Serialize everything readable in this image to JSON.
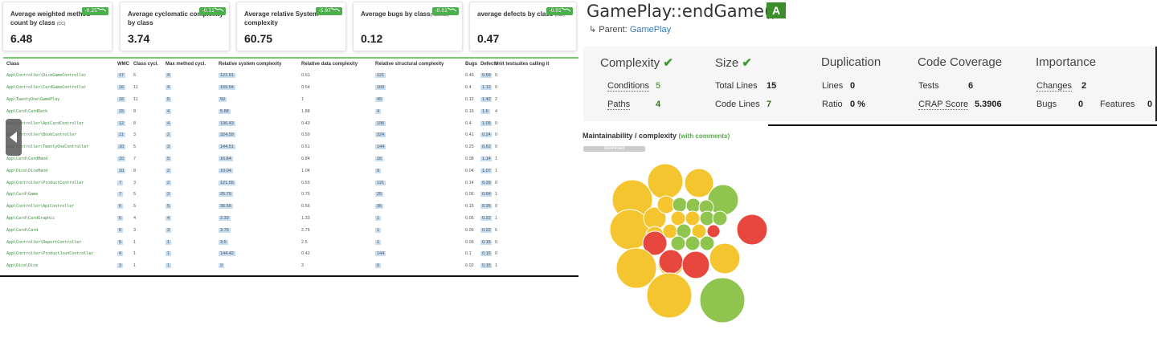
{
  "cards": [
    {
      "title": "Average weighted method count by class",
      "note": "(CC)",
      "value": "6.48",
      "badge": "-0.25"
    },
    {
      "title": "Average cyclomatic complexity by class",
      "note": "",
      "value": "3.74",
      "badge": "-0.11"
    },
    {
      "title": "Average relative System complexity",
      "note": "",
      "value": "60.75",
      "badge": "-5.97"
    },
    {
      "title": "Average bugs by class",
      "note": "(Halstead)",
      "value": "0.12",
      "badge": "-0.01"
    },
    {
      "title": "average defects by class",
      "note": "(Kan)",
      "value": "0.47",
      "badge": "-0.01"
    }
  ],
  "table": {
    "headers": [
      "Class",
      "WMC",
      "Class cycl.",
      "Max method cycl.",
      "Relative system complexity",
      "Relative data complexity",
      "Relative structural complexity",
      "Bugs",
      "Defects",
      "Unit testsuites calling it"
    ],
    "rows": [
      [
        "App\\Controller\\DiceGameController",
        "17",
        "6",
        "4",
        "121.61",
        "0.61",
        "121",
        "0.46",
        "0.59",
        "0"
      ],
      [
        "App\\Controller\\CardGameController",
        "16",
        "11",
        "4",
        "169.54",
        "0.54",
        "169",
        "0.4",
        "1.12",
        "0"
      ],
      [
        "App\\TwentyOne\\GamePlay",
        "16",
        "11",
        "5",
        "50",
        "1",
        "49",
        "0.12",
        "1.42",
        "2"
      ],
      [
        "App\\Card\\CardDeck",
        "15",
        "8",
        "4",
        "5.88",
        "1.88",
        "4",
        "0.16",
        "1.6",
        "4"
      ],
      [
        "App\\Controller\\ApiCardController",
        "12",
        "8",
        "4",
        "196.43",
        "0.43",
        "196",
        "0.4",
        "1.05",
        "0"
      ],
      [
        "App\\Controller\\BookController",
        "11",
        "3",
        "2",
        "324.59",
        "0.59",
        "324",
        "0.41",
        "0.24",
        "0"
      ],
      [
        "App\\Controller\\TwentyOneController",
        "10",
        "5",
        "3",
        "144.51",
        "0.51",
        "144",
        "0.25",
        "0.52",
        "0"
      ],
      [
        "App\\Card\\CardHand",
        "10",
        "7",
        "5",
        "16.84",
        "0.84",
        "16",
        "0.08",
        "1.14",
        "1"
      ],
      [
        "App\\Dice\\DiceHand",
        "10",
        "8",
        "2",
        "10.04",
        "1.04",
        "9",
        "0.04",
        "1.07",
        "1"
      ],
      [
        "App\\Controller\\ProductController",
        "7",
        "3",
        "2",
        "121.55",
        "0.55",
        "121",
        "0.14",
        "0.29",
        "0"
      ],
      [
        "App\\Card\\Game",
        "7",
        "5",
        "3",
        "25.75",
        "0.75",
        "25",
        "0.06",
        "0.64",
        "1"
      ],
      [
        "App\\Controller\\ApiController",
        "6",
        "5",
        "5",
        "36.56",
        "0.56",
        "36",
        "0.15",
        "0.26",
        "0"
      ],
      [
        "App\\Card\\CardGraphic",
        "6",
        "4",
        "4",
        "2.33",
        "1.33",
        "1",
        "0.06",
        "0.22",
        "1"
      ],
      [
        "App\\Card\\Card",
        "6",
        "3",
        "3",
        "3.75",
        "2.75",
        "1",
        "0.06",
        "0.22",
        "6"
      ],
      [
        "App\\Controller\\ReportController",
        "5",
        "1",
        "1",
        "3.5",
        "2.5",
        "1",
        "0.06",
        "0.15",
        "0"
      ],
      [
        "App\\Controller\\ProductJsonController",
        "4",
        "1",
        "1",
        "144.42",
        "0.42",
        "144",
        "0.1",
        "0.15",
        "0"
      ],
      [
        "App\\Dice\\Dice",
        "3",
        "1",
        "1",
        "3",
        "3",
        "0",
        "0.02",
        "0.15",
        "1"
      ]
    ]
  },
  "detail": {
    "title": "GamePlay::endGame()",
    "grade": "A",
    "parent_prefix": "↳ Parent:",
    "parent_name": "GamePlay",
    "complexity": {
      "heading": "Complexity",
      "conditions_label": "Conditions",
      "conditions": "5",
      "paths_label": "Paths",
      "paths": "4"
    },
    "size": {
      "heading": "Size",
      "total_label": "Total Lines",
      "total": "15",
      "code_label": "Code Lines",
      "code": "7"
    },
    "duplication": {
      "heading": "Duplication",
      "lines_label": "Lines",
      "lines": "0",
      "ratio_label": "Ratio",
      "ratio": "0 %"
    },
    "coverage": {
      "heading": "Code Coverage",
      "tests_label": "Tests",
      "tests": "6",
      "crap_label": "CRAP Score",
      "crap": "5.3906"
    },
    "importance": {
      "heading": "Importance",
      "changes_label": "Changes",
      "changes": "2",
      "bugs_label": "Bugs",
      "bugs": "0",
      "features_label": "Features",
      "features": "0"
    }
  },
  "maintainability": {
    "title": "Maintainability / complexity",
    "subtitle": "(with comments)",
    "download_label": "download",
    "colors": {
      "yellow": "#f5c530",
      "green": "#8fc44f",
      "red": "#e8473e"
    }
  }
}
